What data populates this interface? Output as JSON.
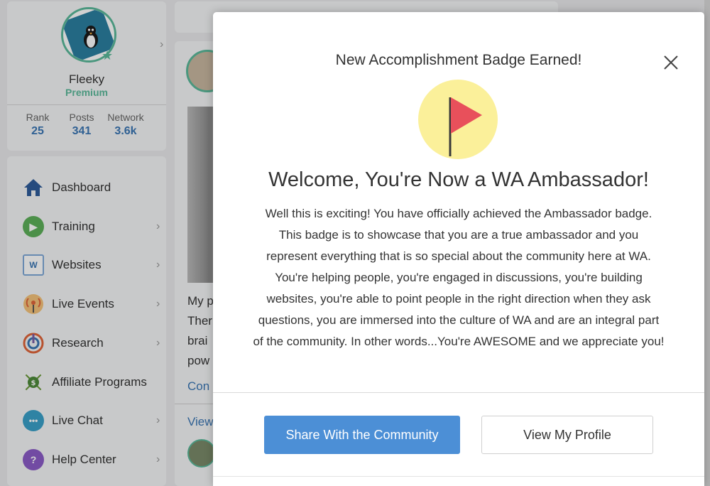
{
  "profile": {
    "name": "Fleeky",
    "tier": "Premium",
    "stats": [
      {
        "label": "Rank",
        "value": "25"
      },
      {
        "label": "Posts",
        "value": "341"
      },
      {
        "label": "Network",
        "value": "3.6k"
      }
    ]
  },
  "sidebar": {
    "items": [
      {
        "label": "Dashboard",
        "icon": "home-icon"
      },
      {
        "label": "Training",
        "icon": "play-icon"
      },
      {
        "label": "Websites",
        "icon": "websites-icon"
      },
      {
        "label": "Live Events",
        "icon": "broadcast-icon"
      },
      {
        "label": "Research",
        "icon": "research-icon"
      },
      {
        "label": "Affiliate Programs",
        "icon": "affiliate-network-icon"
      },
      {
        "label": "Live Chat",
        "icon": "chat-bubble-icon"
      },
      {
        "label": "Help Center",
        "icon": "help-icon"
      }
    ]
  },
  "feed": {
    "post_lines": [
      "My p",
      "Ther",
      "brai",
      "pow"
    ],
    "link_text": "Con",
    "view_link": "View"
  },
  "modal": {
    "header_title": "New Accomplishment Badge Earned!",
    "heading": "Welcome, You're Now a WA Ambassador!",
    "body": "Well this is exciting! You have officially achieved the Ambassador badge. This badge is to showcase that you are a true ambassador and you represent everything that is so special about the community here at WA. You're helping people, you're engaged in discussions, you're building websites, you're able to point people in the right direction when they ask questions, you are immersed into the culture of WA and are an integral part of the community. In other words...You're AWESOME and we appreciate you!",
    "primary_button": "Share With the Community",
    "secondary_button": "View My Profile"
  },
  "colors": {
    "accent_green": "#5bb99a",
    "link_blue": "#3a76b4",
    "primary_button": "#4c8fd6",
    "badge_yellow": "#fbf09a",
    "flag_red": "#e8505b"
  }
}
